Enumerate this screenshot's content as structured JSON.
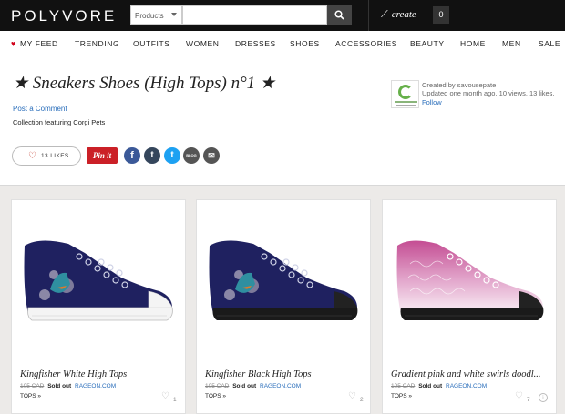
{
  "header": {
    "logo": "POLYVORE",
    "search_category": "Products",
    "search_placeholder": "",
    "create_label": "create",
    "notification_count": "0"
  },
  "nav": {
    "items": [
      "MY FEED",
      "TRENDING",
      "OUTFITS",
      "WOMEN",
      "DRESSES",
      "SHOES",
      "ACCESSORIES",
      "BEAUTY",
      "HOME",
      "MEN",
      "SALE"
    ]
  },
  "collection": {
    "title": "★ Sneakers Shoes (High Tops) n°1 ★",
    "post_comment": "Post a Comment",
    "description": "Collection featuring Corgi Pets",
    "creator_line1": "Created by savousepate",
    "creator_line2": "Updated one month ago. 10 views. 13 likes.",
    "follow": "Follow"
  },
  "actions": {
    "like_label": "13 LIKES",
    "pinit": "Pin it",
    "social": [
      "f",
      "t",
      "t",
      "BLOG",
      "✉"
    ]
  },
  "products": [
    {
      "title": "Kingfisher White High Tops",
      "old_price": "105 CAD",
      "status": "Sold out",
      "store": "RAGEON.COM",
      "category": "TOPS »",
      "likes": "1"
    },
    {
      "title": "Kingfisher Black High Tops",
      "old_price": "105 CAD",
      "status": "Sold out",
      "store": "RAGEON.COM",
      "category": "TOPS »",
      "likes": "2"
    },
    {
      "title": "Gradient pink and white swirls doodl...",
      "old_price": "105 CAD",
      "status": "Sold out",
      "store": "RAGEON.COM",
      "category": "TOPS »",
      "likes": "7"
    }
  ],
  "colors": {
    "topbar": "#111111",
    "link": "#2a6ebb",
    "heart": "#d0021b",
    "pinterest": "#cb2027",
    "facebook": "#3b5998",
    "tumblr": "#35465c",
    "twitter": "#1da1f2",
    "shoe_navy": "#1f2160"
  }
}
